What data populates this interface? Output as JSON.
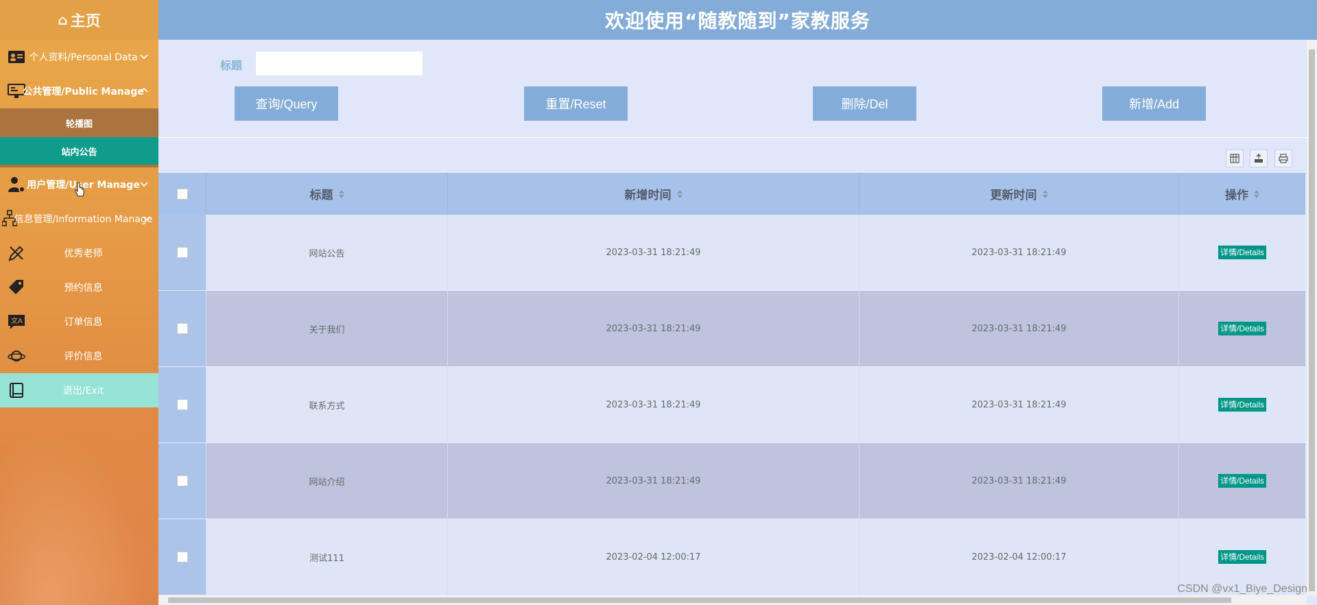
{
  "sidebar": {
    "home_label": "主页",
    "menus": {
      "personal": "个人资料/Personal Data",
      "public": "公共管理/Public Manage",
      "public_sub": [
        "轮播图",
        "站内公告"
      ],
      "user": "用户管理/User Manage",
      "info": "信息管理/Information Manage",
      "items": [
        "优秀老师",
        "预约信息",
        "订单信息",
        "评价信息"
      ],
      "exit": "退出/Exit"
    }
  },
  "header": {
    "title": "欢迎使用“随教随到”家教服务"
  },
  "search": {
    "label": "标题",
    "value": "",
    "buttons": {
      "query": "查询/Query",
      "reset": "重置/Reset",
      "delete": "删除/Del",
      "add": "新增/Add"
    }
  },
  "table": {
    "headers": {
      "title": "标题",
      "created": "新增时间",
      "updated": "更新时间",
      "ops": "操作"
    },
    "rows": [
      {
        "title": "网站公告",
        "created": "2023-03-31 18:21:49",
        "updated": "2023-03-31 18:21:49",
        "action": "详情/Details"
      },
      {
        "title": "关于我们",
        "created": "2023-03-31 18:21:49",
        "updated": "2023-03-31 18:21:49",
        "action": "详情/Details"
      },
      {
        "title": "联系方式",
        "created": "2023-03-31 18:21:49",
        "updated": "2023-03-31 18:21:49",
        "action": "详情/Details"
      },
      {
        "title": "网站介绍",
        "created": "2023-03-31 18:21:49",
        "updated": "2023-03-31 18:21:49",
        "action": "详情/Details"
      },
      {
        "title": "测试111",
        "created": "2023-02-04 12:00:17",
        "updated": "2023-02-04 12:00:17",
        "action": "详情/Details"
      }
    ]
  },
  "watermark": "CSDN @vx1_Biye_Design",
  "colors": {
    "header": "#84acd9",
    "accent": "#009688",
    "sidebar": "#e69a45"
  }
}
